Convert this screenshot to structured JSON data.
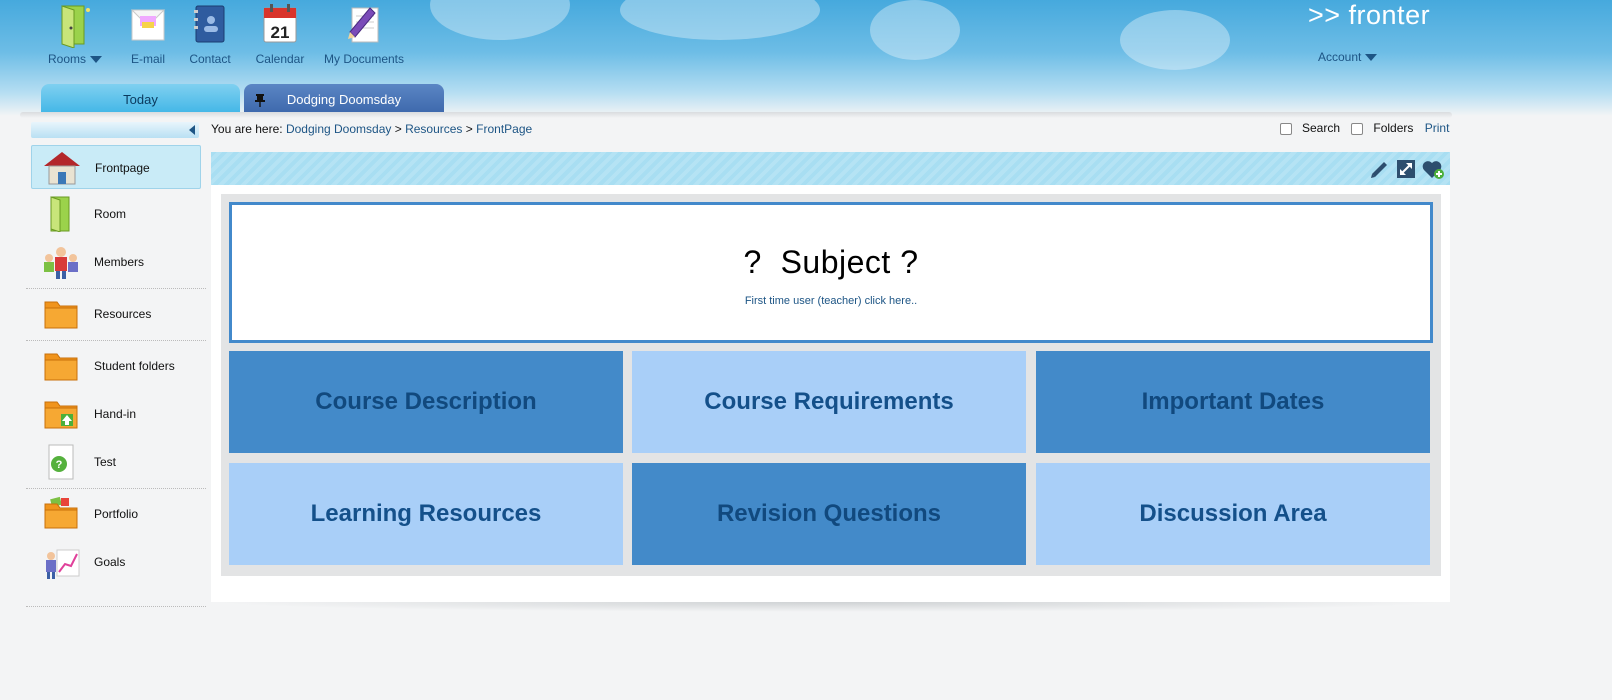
{
  "top_nav": {
    "rooms_label": "Rooms",
    "email_label": "E-mail",
    "contact_label": "Contact",
    "calendar_label": "Calendar",
    "calendar_day": "21",
    "documents_label": "My Documents"
  },
  "brand": {
    "logo": ">> fronter",
    "account_label": "Account"
  },
  "tabs": {
    "today": "Today",
    "room": "Dodging Doomsday"
  },
  "sidebar": {
    "items": [
      {
        "label": "Frontpage"
      },
      {
        "label": "Room"
      },
      {
        "label": "Members"
      },
      {
        "label": "Resources"
      },
      {
        "label": "Student folders"
      },
      {
        "label": "Hand-in"
      },
      {
        "label": "Test"
      },
      {
        "label": "Portfolio"
      },
      {
        "label": "Goals"
      }
    ]
  },
  "breadcrumb": {
    "prefix": "You are here:",
    "sep": ">",
    "crumbs": [
      "Dodging Doomsday",
      "Resources",
      "FrontPage"
    ]
  },
  "tools": {
    "search_label": "Search",
    "folders_label": "Folders",
    "print_label": "Print"
  },
  "frontpage": {
    "title": "?  Subject ?",
    "link": "First time user (teacher) click here..",
    "tiles": [
      "Course Description",
      "Course Requirements",
      "Important Dates",
      "Learning Resources",
      "Revision Questions",
      "Discussion Area"
    ]
  },
  "colors": {
    "accent": "#438ac9",
    "tile_light": "#a9cff8",
    "header_blue": "#46a9dd",
    "link": "#1d5585"
  }
}
